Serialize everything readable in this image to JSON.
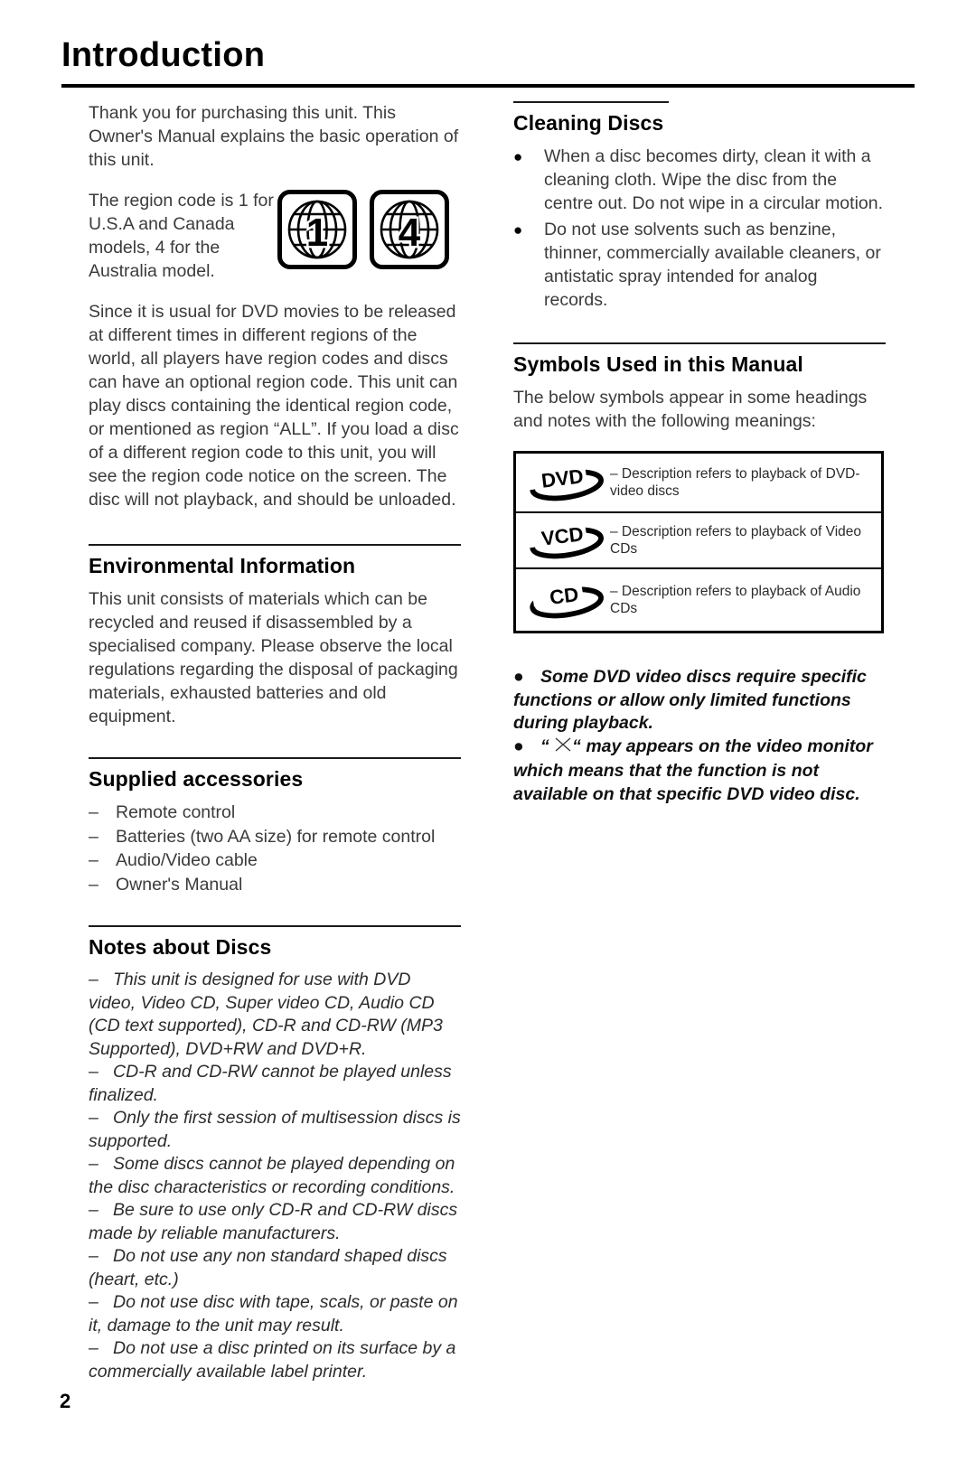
{
  "document": {
    "title": "Introduction",
    "page_number": "2"
  },
  "left_column": {
    "intro_paragraph": "Thank you for purchasing this unit. This Owner's Manual explains the basic operation of this unit.",
    "region_code": {
      "text": "The region code is 1 for U.S.A and Canada models, 4 for the Australia model.",
      "badges": [
        {
          "name": "globe-region-1",
          "label": "1"
        },
        {
          "name": "globe-region-4",
          "label": "4"
        }
      ]
    },
    "region_paragraph": "Since it is usual for DVD movies to be released at different times in different regions of the world, all players have region codes and discs can have an optional region code. This unit can play discs containing the identical region code, or mentioned as region “ALL”. If you load a disc of a different region code to this unit, you will see the region code notice on the screen. The disc will not playback, and should be unloaded.",
    "environmental": {
      "heading": "Environmental Information",
      "paragraph": "This unit consists of materials which can be recycled and reused if disassembled by a specialised company. Please observe the local regulations regarding the disposal of packaging materials, exhausted batteries and old equipment."
    },
    "supplied_accessories": {
      "heading": "Supplied accessories",
      "dash": "–",
      "items": [
        "Remote control",
        "Batteries (two AA size) for remote control",
        "Audio/Video cable",
        "Owner's Manual"
      ]
    },
    "notes_about_discs": {
      "heading": "Notes about Discs",
      "dash": "–",
      "notes": [
        "This unit is designed for use with DVD video, Video CD, Super video CD, Audio CD (CD text supported), CD-R and CD-RW (MP3 Supported), DVD+RW and DVD+R.",
        "CD-R and CD-RW cannot be played unless finalized.",
        "Only the first session of multisession discs is supported.",
        "Some discs cannot be played depending on the disc characteristics or recording conditions.",
        "Be sure to use only CD-R and CD-RW discs made by reliable manufacturers.",
        "Do not use any non standard shaped discs (heart, etc.)",
        "Do not use disc with tape, scals, or paste on it, damage to the unit may result.",
        "Do not use a disc printed on its surface by a commercially available label printer."
      ]
    }
  },
  "right_column": {
    "cleaning_discs": {
      "heading": "Cleaning Discs",
      "bullet": "●",
      "items": [
        "When a disc becomes dirty, clean it with a cleaning cloth. Wipe the disc from the centre out. Do not wipe in a circular motion.",
        "Do not use solvents such as benzine, thinner, commercially available cleaners, or antistatic spray intended for analog records."
      ]
    },
    "symbols_used": {
      "heading": "Symbols Used in this Manual",
      "intro": "The below symbols appear in some headings and notes with the following meanings:",
      "table": [
        {
          "logo": "DVD",
          "description": "– Description refers to playback of DVD-video discs"
        },
        {
          "logo": "VCD",
          "description": "– Description refers to playback of Video CDs"
        },
        {
          "logo": "CD",
          "description": "– Description refers to playback of Audio CDs"
        }
      ]
    },
    "emphasis_notes": {
      "bullet": "●",
      "items": [
        "Some DVD video discs require specific functions or allow only limited functions during playback.",
        "“ ✕ “ may appears on the video monitor which means that the function is not available on that specific DVD video disc."
      ],
      "note2_prefix": "“",
      "note2_suffix": "“ may appears on the video monitor which means that the function is not available on that specific DVD video disc."
    }
  }
}
